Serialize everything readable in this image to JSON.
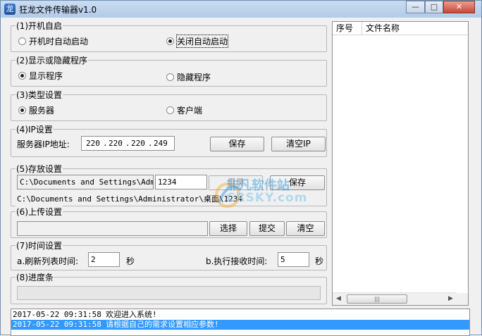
{
  "window": {
    "title": "狂龙文件传输器v1.0",
    "icon": "dragon-app-icon",
    "controls": {
      "minimize": "—",
      "maximize": "□",
      "close": "✕"
    }
  },
  "startup": {
    "legend": "(1)开机自启",
    "opt_auto": "开机时自动启动",
    "opt_off": "关闭自动启动",
    "selected": "off"
  },
  "visibility": {
    "legend": "(2)显示或隐藏程序",
    "opt_show": "显示程序",
    "opt_hide": "隐藏程序",
    "selected": "show"
  },
  "type": {
    "legend": "(3)类型设置",
    "opt_server": "服务器",
    "opt_client": "客户端",
    "selected": "server"
  },
  "ip": {
    "legend": "(4)IP设置",
    "label": "服务器IP地址:",
    "octets": [
      "220",
      "220",
      "220",
      "249"
    ],
    "save": "保存",
    "clear": "清空IP"
  },
  "storage": {
    "legend": "(5)存放设置",
    "path_value": "C:\\Documents and Settings\\Administrator\\桌面",
    "folder_value": "1234",
    "dir_button": "目录",
    "save": "保存",
    "full_path": "C:\\Documents and Settings\\Administrator\\桌面\\1234"
  },
  "upload": {
    "legend": "(6)上传设置",
    "file_value": "",
    "select": "选择",
    "submit": "提交",
    "clear": "清空"
  },
  "timing": {
    "legend": "(7)时间设置",
    "refresh_label": "a.刷新列表时间:",
    "refresh_value": "2",
    "refresh_unit": "秒",
    "receive_label": "b.执行接收时间:",
    "receive_value": "5",
    "receive_unit": "秒"
  },
  "progress": {
    "legend": "(8)进度条",
    "value": 0
  },
  "file_list": {
    "columns": [
      "序号",
      "文件名称"
    ],
    "rows": []
  },
  "log": [
    {
      "time": "2017-05-22 09:31:58",
      "message": "欢迎进入系统!",
      "selected": false
    },
    {
      "time": "2017-05-22 09:31:58",
      "message": "请根据自己的需求设置相应参数!",
      "selected": true
    }
  ],
  "watermark": {
    "title": "非凡软件站",
    "subtitle": "CRSKY.com"
  },
  "colors": {
    "title_bar": "#b3cbe8",
    "selection": "#3399ff",
    "window_bg": "#f0f0f0"
  }
}
